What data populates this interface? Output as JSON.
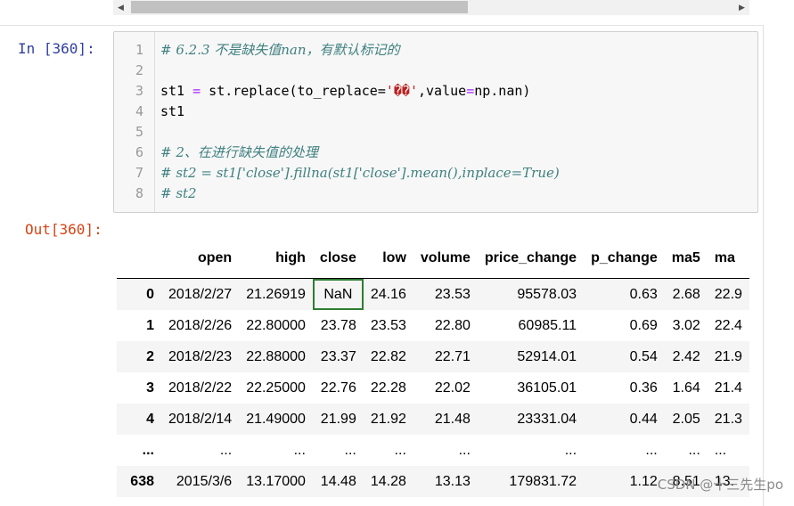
{
  "scrollbar": {
    "left_arrow": "◀",
    "right_arrow": "▶"
  },
  "cell": {
    "in_prompt": "In  [360]:",
    "out_prompt": "Out[360]:",
    "line_numbers": [
      "1",
      "2",
      "3",
      "4",
      "5",
      "6",
      "7",
      "8"
    ],
    "code": {
      "line1": "# 6.2.3 不是缺失值nan，有默认标记的",
      "line3_a": "st1 ",
      "line3_b": "=",
      "line3_c": " st.replace(to_replace=",
      "line3_d": "'��'",
      "line3_e": ",value",
      "line3_f": "=",
      "line3_g": "np.nan)",
      "line4": "st1",
      "line6": "# 2、在进行缺失值的处理",
      "line7": "# st2 = st1['close'].fillna(st1['close'].mean(),inplace=True)",
      "line8": "# st2"
    }
  },
  "output_table": {
    "columns": [
      "",
      "open",
      "high",
      "close",
      "low",
      "volume",
      "price_change",
      "p_change",
      "ma5",
      "ma"
    ],
    "rows": [
      {
        "index": "0",
        "cells": [
          "2018/2/27",
          "21.26919",
          "NaN",
          "24.16",
          "23.53",
          "95578.03",
          "0.63",
          "2.68",
          "22.9"
        ]
      },
      {
        "index": "1",
        "cells": [
          "2018/2/26",
          "22.80000",
          "23.78",
          "23.53",
          "22.80",
          "60985.11",
          "0.69",
          "3.02",
          "22.4"
        ]
      },
      {
        "index": "2",
        "cells": [
          "2018/2/23",
          "22.88000",
          "23.37",
          "22.82",
          "22.71",
          "52914.01",
          "0.54",
          "2.42",
          "21.9"
        ]
      },
      {
        "index": "3",
        "cells": [
          "2018/2/22",
          "22.25000",
          "22.76",
          "22.28",
          "22.02",
          "36105.01",
          "0.36",
          "1.64",
          "21.4"
        ]
      },
      {
        "index": "4",
        "cells": [
          "2018/2/14",
          "21.49000",
          "21.99",
          "21.92",
          "21.48",
          "23331.04",
          "0.44",
          "2.05",
          "21.3"
        ]
      },
      {
        "index": "...",
        "cells": [
          "...",
          "...",
          "...",
          "...",
          "...",
          "...",
          "...",
          "...",
          "..."
        ]
      },
      {
        "index": "638",
        "cells": [
          "2015/3/6",
          "13.17000",
          "14.48",
          "14.28",
          "13.13",
          "179831.72",
          "1.12",
          "8.51",
          "13."
        ]
      }
    ]
  },
  "watermark": "CSDN @十三先生po",
  "colors": {
    "in_prompt": "#303f9f",
    "out_prompt": "#d84315",
    "highlight_box": "#2e7d32",
    "comment": "#408080",
    "string": "#ba2121"
  }
}
